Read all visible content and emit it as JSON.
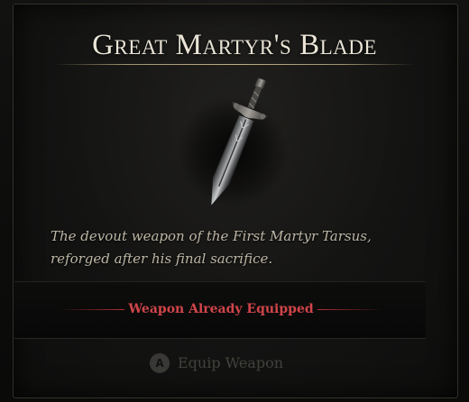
{
  "item": {
    "name": "Great Martyr's Blade",
    "image_icon": "greatsword-icon",
    "description": "The devout weapon of the First Martyr Tarsus, reforged after his final sacrifice."
  },
  "status": {
    "text": "Weapon Already Equipped",
    "color": "#d0454a"
  },
  "action": {
    "button_glyph": "A",
    "button_icon": "a-button-icon",
    "label": "Equip Weapon",
    "enabled": false
  },
  "colors": {
    "title": "#e9e4d6",
    "description": "#bdb6a5",
    "accent_red": "#c33b40",
    "rule_gold": "#bea982"
  }
}
